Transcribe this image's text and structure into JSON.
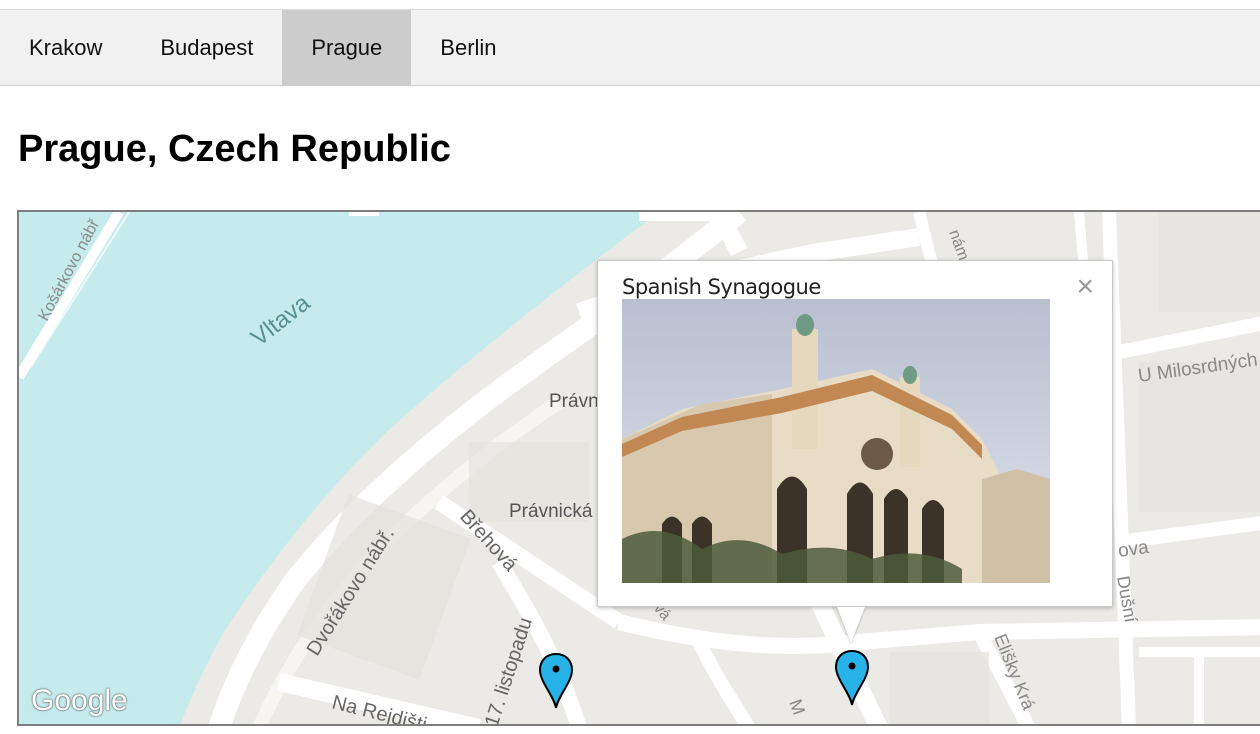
{
  "tabs": [
    {
      "label": "Krakow",
      "active": false
    },
    {
      "label": "Budapest",
      "active": false
    },
    {
      "label": "Prague",
      "active": true
    },
    {
      "label": "Berlin",
      "active": false
    }
  ],
  "page": {
    "title": "Prague, Czech Republic"
  },
  "map": {
    "provider_logo": "Google",
    "labels": {
      "river": "Vltava",
      "kosarkovo": "Košárkovo nábř",
      "pravnicka_top": "Právn",
      "pravnicka": "Právnická",
      "brehova": "Břehová",
      "dvorakovo": "Dvořákovo nábř.",
      "listopadu": "17. listopadu",
      "na_rejdisti": "Na Rejdišti",
      "u_milosrdnych": "U Milosrdných",
      "ova": "ova",
      "dusni": "Dušní",
      "elisky": "Elišky Krá",
      "nam": "nám",
      "m": "M",
      "ova2": "ová"
    },
    "marker_color": "#27b3e8",
    "water_color": "#c5ebec"
  },
  "infowindow": {
    "title": "Spanish Synagogue",
    "close_icon": "close-icon",
    "photo_alt": "Spanish Synagogue photo"
  }
}
